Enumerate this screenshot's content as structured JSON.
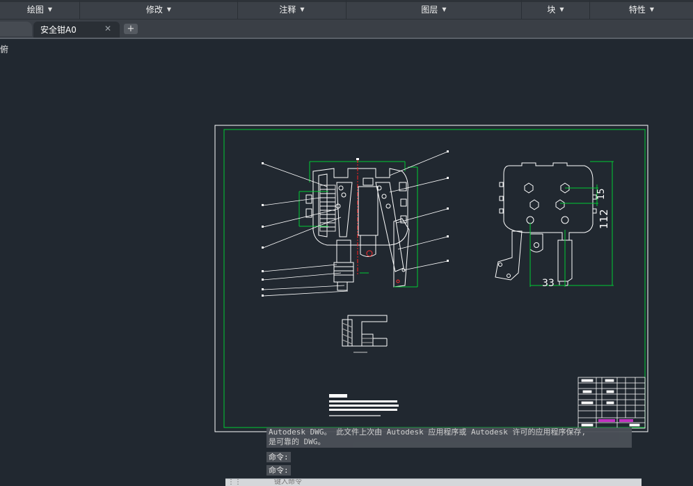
{
  "ribbon": {
    "panels": [
      {
        "label": "绘图"
      },
      {
        "label": "修改"
      },
      {
        "label": "注释"
      },
      {
        "label": "图层"
      },
      {
        "label": "块"
      },
      {
        "label": "特性"
      }
    ]
  },
  "tabs": {
    "active": "安全钳A0",
    "close_glyph": "✕",
    "add_glyph": "+"
  },
  "viewport": {
    "label": "俯"
  },
  "drawing": {
    "dim_15": "15",
    "dim_112": "112",
    "dim_33": "33"
  },
  "command": {
    "history_line1": "Autodesk DWG。  此文件上次由 Autodesk 应用程序或 Autodesk 许可的应用程序保存,",
    "history_line2": "是可靠的 DWG。",
    "prompt1": "命令:",
    "prompt2": "命令:",
    "input_placeholder": "键入命令"
  },
  "colors": {
    "background": "#212830",
    "paper": "#ffffff",
    "frame": "#00cc33",
    "center_line": "#ff2020"
  }
}
